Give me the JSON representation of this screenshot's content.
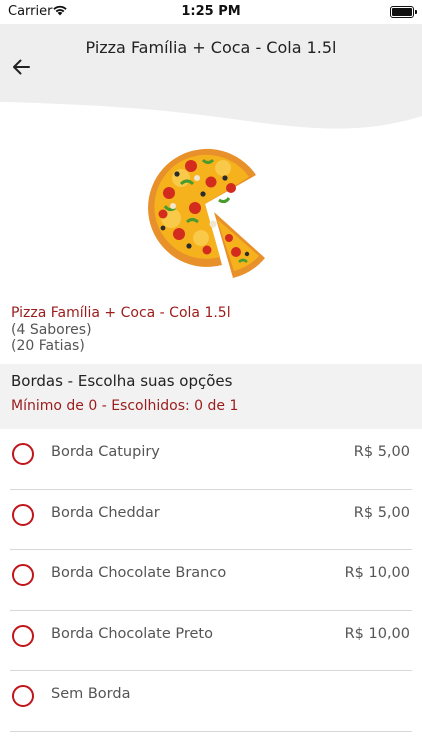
{
  "status_bar": {
    "carrier": "Carrier",
    "time": "1:25 PM"
  },
  "header": {
    "title": "Pizza Família + Coca - Cola 1.5l"
  },
  "product": {
    "image": "pizza-illustration",
    "name": "Pizza Família + Coca - Cola 1.5l",
    "flavors": "(4 Sabores)",
    "slices": "(20 Fatias)"
  },
  "section": {
    "title": "Bordas - Escolha suas opções",
    "subtitle": "Mínimo de 0 - Escolhidos: 0 de 1"
  },
  "options": [
    {
      "label": "Borda Catupiry",
      "price": "R$ 5,00"
    },
    {
      "label": "Borda Cheddar",
      "price": "R$ 5,00"
    },
    {
      "label": "Borda Chocolate Branco",
      "price": "R$ 10,00"
    },
    {
      "label": "Borda Chocolate Preto",
      "price": "R$ 10,00"
    },
    {
      "label": "Sem Borda",
      "price": ""
    }
  ],
  "colors": {
    "accent": "#c0151a",
    "product_name": "#9b1c1c",
    "section_bg": "#f2f2f2"
  }
}
